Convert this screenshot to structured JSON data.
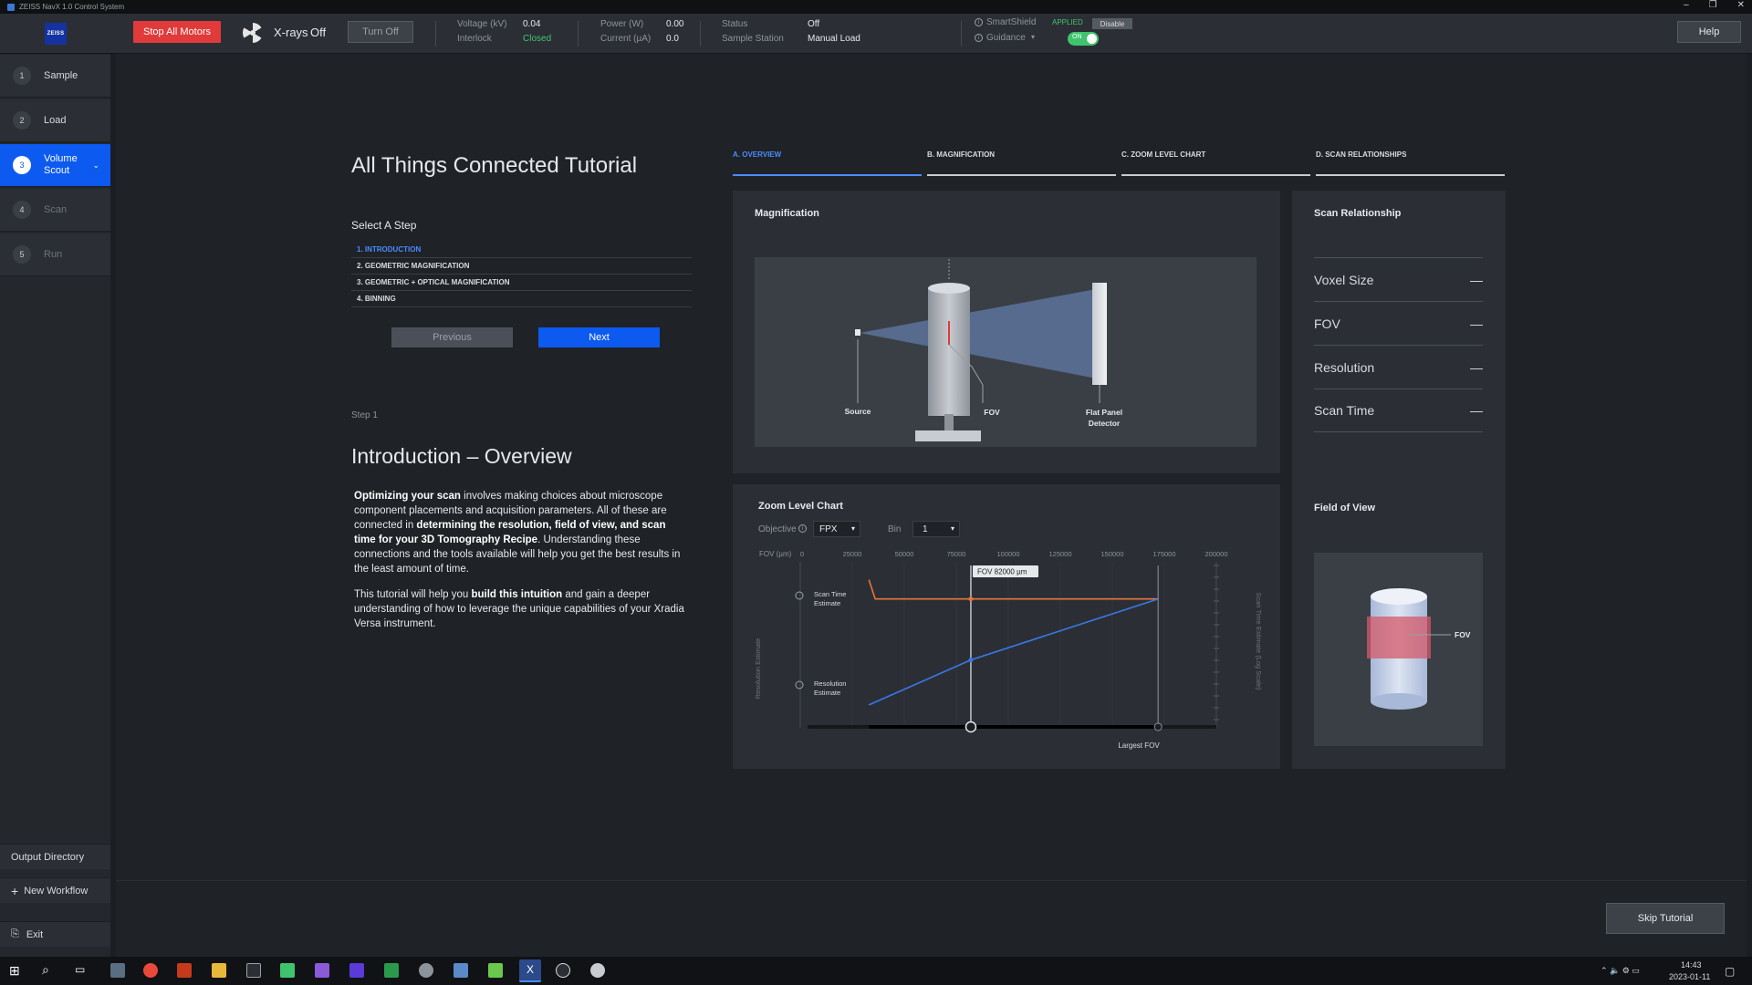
{
  "window": {
    "title": "ZEISS NavX 1.0 Control System"
  },
  "topbar": {
    "logo": "ZEISS",
    "stop_label": "Stop All Motors",
    "xrays_label": "X-rays",
    "xrays_state": "Off",
    "turnoff_label": "Turn Off",
    "voltage_label": "Voltage (kV)",
    "voltage_value": "0.04",
    "interlock_label": "Interlock",
    "interlock_value": "Closed",
    "power_label": "Power (W)",
    "power_value": "0.00",
    "current_label": "Current (µA)",
    "current_value": "0.0",
    "status_label": "Status",
    "status_value": "Off",
    "station_label": "Sample Station",
    "station_value": "Manual Load",
    "smartshield_label": "SmartShield",
    "smartshield_state": "APPLIED",
    "disable_label": "Disable",
    "guidance_label": "Guidance",
    "guidance_toggle": "ON",
    "help_label": "Help"
  },
  "sidebar": {
    "steps": [
      {
        "num": "1",
        "label": "Sample"
      },
      {
        "num": "2",
        "label": "Load"
      },
      {
        "num": "3",
        "label": "Volume Scout"
      },
      {
        "num": "4",
        "label": "Scan"
      },
      {
        "num": "5",
        "label": "Run"
      }
    ],
    "output_directory": "Output Directory",
    "new_workflow": "New Workflow",
    "exit": "Exit"
  },
  "tutorial": {
    "title": "All Things Connected Tutorial",
    "select_step": "Select A Step",
    "steps": [
      "1. INTRODUCTION",
      "2. GEOMETRIC MAGNIFICATION",
      "3. GEOMETRIC + OPTICAL MAGNIFICATION",
      "4. BINNING"
    ],
    "previous_label": "Previous",
    "next_label": "Next",
    "step_label": "Step 1",
    "heading": "Introduction – Overview",
    "p1_b1": "Optimizing your scan",
    "p1_t1": " involves making choices about microscope component placements and acquisition parameters. All of these are connected in ",
    "p1_b2": "determining the resolution, field of view, and scan time for your 3D Tomography Recipe",
    "p1_t2": ". Understanding these connections and the tools available will help you get the best results in the least amount of time.",
    "p2_t1": "This tutorial will help you ",
    "p2_b1": "build this intuition",
    "p2_t2": " and gain a deeper understanding of how to leverage the unique capabilities of your Xradia Versa instrument.",
    "skip_label": "Skip Tutorial"
  },
  "tabs": [
    "A. OVERVIEW",
    "B. MAGNIFICATION",
    "C. ZOOM LEVEL CHART",
    "D. SCAN RELATIONSHIPS"
  ],
  "magnification": {
    "title": "Magnification",
    "source_label": "Source",
    "fov_label": "FOV",
    "detector_label_1": "Flat Panel",
    "detector_label_2": "Detector"
  },
  "zoom_chart": {
    "title": "Zoom Level Chart",
    "objective_label": "Objective",
    "objective_value": "FPX",
    "bin_label": "Bin",
    "bin_value": "1",
    "fov_axis_label": "FOV (µm)",
    "fov_callout": "FOV 82000 µm",
    "scan_time_label_1": "Scan Time",
    "scan_time_label_2": "Estimate",
    "resolution_label_1": "Resolution",
    "resolution_label_2": "Estimate",
    "left_axis_label": "Resolution Estimate",
    "right_axis_label": "Scan Time Estimate (Log Scale)",
    "largest_fov_label": "Largest FOV"
  },
  "chart_data": {
    "type": "line",
    "x_ticks": [
      "0",
      "25000",
      "50000",
      "75000",
      "100000",
      "125000",
      "150000",
      "175000",
      "200000"
    ],
    "xlim": [
      0,
      200000
    ],
    "series": [
      {
        "name": "Scan Time Estimate",
        "color": "#e8743b",
        "x": [
          33000,
          36000,
          82000,
          172000
        ],
        "y": [
          0.9,
          0.78,
          0.78,
          0.78
        ]
      },
      {
        "name": "Resolution Estimate",
        "color": "#3a78e8",
        "x": [
          33000,
          82000,
          172000
        ],
        "y": [
          0.12,
          0.4,
          0.78
        ]
      }
    ],
    "current_fov": 82000,
    "largest_fov": 172000
  },
  "scan_relationship": {
    "title": "Scan Relationship",
    "rows": [
      {
        "label": "Voxel Size",
        "value": "—"
      },
      {
        "label": "FOV",
        "value": "—"
      },
      {
        "label": "Resolution",
        "value": "—"
      },
      {
        "label": "Scan Time",
        "value": "—"
      }
    ],
    "fov_title": "Field of View",
    "fov_label": "FOV"
  },
  "taskbar": {
    "time": "14:43",
    "date": "2023-01-11"
  }
}
